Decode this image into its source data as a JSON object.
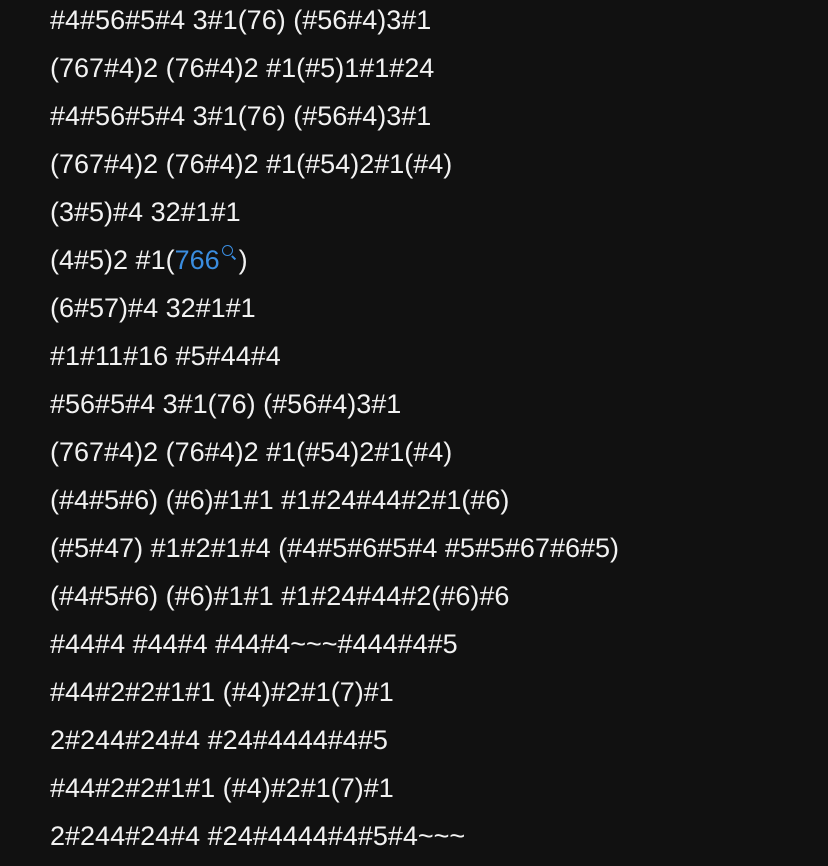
{
  "lines": [
    "#4#56#5#4 3#1(76) (#56#4)3#1",
    "(767#4)2 (76#4)2 #1(#5)1#1#24",
    "#4#56#5#4 3#1(76) (#56#4)3#1",
    "(767#4)2 (76#4)2 #1(#54)2#1(#4)",
    "(3#5)#4 32#1#1",
    {
      "prefix": "(4#5)2 #1(",
      "link": "766",
      "suffix": ")"
    },
    "(6#57)#4 32#1#1",
    "#1#11#16 #5#44#4",
    "#56#5#4 3#1(76) (#56#4)3#1",
    "(767#4)2 (76#4)2 #1(#54)2#1(#4)",
    "(#4#5#6) (#6)#1#1 #1#24#44#2#1(#6)",
    "(#5#47) #1#2#1#4 (#4#5#6#5#4 #5#5#67#6#5)",
    "(#4#5#6) (#6)#1#1 #1#24#44#2(#6)#6",
    "#44#4 #44#4 #44#4~~~#444#4#5",
    "#44#2#2#1#1 (#4)#2#1(7)#1",
    "2#244#24#4 #24#4444#4#5",
    "#44#2#2#1#1 (#4)#2#1(7)#1",
    "2#244#24#4 #24#4444#4#5#4~~~"
  ],
  "colors": {
    "background": "#111111",
    "text": "#f2f2f2",
    "link": "#3a8de0"
  },
  "icons": {
    "link_icon": "search-icon"
  }
}
